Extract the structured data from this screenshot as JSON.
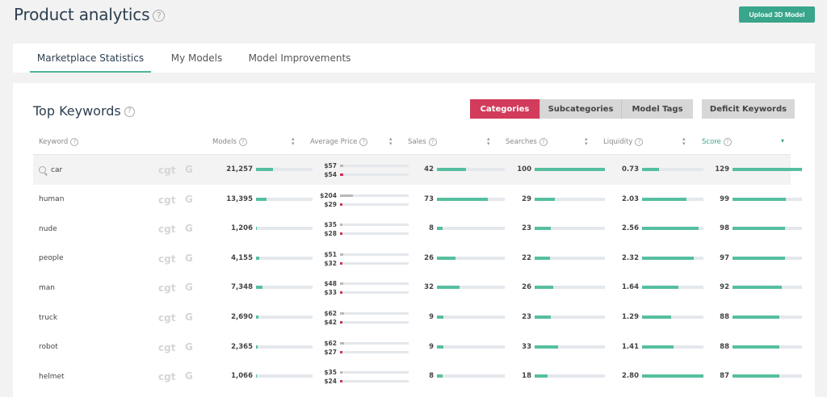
{
  "header": {
    "title": "Product analytics",
    "help_icon": "?",
    "upload_label": "Upload 3D Model"
  },
  "tabs": [
    {
      "label": "Marketplace Statistics",
      "active": true
    },
    {
      "label": "My Models",
      "active": false
    },
    {
      "label": "Model Improvements",
      "active": false
    }
  ],
  "panel": {
    "title": "Top Keywords",
    "filters": [
      {
        "label": "Categories",
        "active": true
      },
      {
        "label": "Subcategories",
        "active": false
      },
      {
        "label": "Model Tags",
        "active": false
      }
    ],
    "deficit_label": "Deficit Keywords"
  },
  "columns": {
    "keyword": "Keyword",
    "models": "Models",
    "average_price": "Average Price",
    "sales": "Sales",
    "searches": "Searches",
    "liquidity": "Liquidity",
    "score": "Score"
  },
  "brand": {
    "cgt": "cgt",
    "google": "G"
  },
  "colors": {
    "accent": "#39a58b",
    "bar": "#55bfa0",
    "active_filter": "#d23b5b",
    "price_low": "#cc3358",
    "price_high": "#b8b8b8"
  },
  "rows": [
    {
      "keyword": "car",
      "models": "21,257",
      "models_level": 0.3,
      "price_high": "$57",
      "price_high_level": 0.05,
      "price_low": "$54",
      "price_low_level": 0.05,
      "sales": "42",
      "sales_level": 0.43,
      "searches": "100",
      "searches_level": 1.0,
      "liquidity": "0.73",
      "liquidity_level": 0.27,
      "score": "129",
      "score_level": 1.0
    },
    {
      "keyword": "human",
      "models": "13,395",
      "models_level": 0.19,
      "price_high": "$204",
      "price_high_level": 0.19,
      "price_low": "$29",
      "price_low_level": 0.03,
      "sales": "73",
      "sales_level": 0.75,
      "searches": "29",
      "searches_level": 0.29,
      "liquidity": "2.03",
      "liquidity_level": 0.73,
      "score": "99",
      "score_level": 0.77
    },
    {
      "keyword": "nude",
      "models": "1,206",
      "models_level": 0.02,
      "price_high": "$35",
      "price_high_level": 0.03,
      "price_low": "$28",
      "price_low_level": 0.03,
      "sales": "8",
      "sales_level": 0.08,
      "searches": "23",
      "searches_level": 0.23,
      "liquidity": "2.56",
      "liquidity_level": 0.92,
      "score": "98",
      "score_level": 0.76
    },
    {
      "keyword": "people",
      "models": "4,155",
      "models_level": 0.06,
      "price_high": "$51",
      "price_high_level": 0.05,
      "price_low": "$32",
      "price_low_level": 0.03,
      "sales": "26",
      "sales_level": 0.27,
      "searches": "22",
      "searches_level": 0.22,
      "liquidity": "2.32",
      "liquidity_level": 0.84,
      "score": "97",
      "score_level": 0.75
    },
    {
      "keyword": "man",
      "models": "7,348",
      "models_level": 0.11,
      "price_high": "$48",
      "price_high_level": 0.05,
      "price_low": "$33",
      "price_low_level": 0.03,
      "sales": "32",
      "sales_level": 0.33,
      "searches": "26",
      "searches_level": 0.26,
      "liquidity": "1.64",
      "liquidity_level": 0.59,
      "score": "92",
      "score_level": 0.71
    },
    {
      "keyword": "truck",
      "models": "2,690",
      "models_level": 0.04,
      "price_high": "$62",
      "price_high_level": 0.06,
      "price_low": "$42",
      "price_low_level": 0.04,
      "sales": "9",
      "sales_level": 0.09,
      "searches": "23",
      "searches_level": 0.23,
      "liquidity": "1.29",
      "liquidity_level": 0.47,
      "score": "88",
      "score_level": 0.68
    },
    {
      "keyword": "robot",
      "models": "2,365",
      "models_level": 0.03,
      "price_high": "$62",
      "price_high_level": 0.06,
      "price_low": "$27",
      "price_low_level": 0.03,
      "sales": "9",
      "sales_level": 0.09,
      "searches": "33",
      "searches_level": 0.33,
      "liquidity": "1.41",
      "liquidity_level": 0.51,
      "score": "88",
      "score_level": 0.68
    },
    {
      "keyword": "helmet",
      "models": "1,066",
      "models_level": 0.02,
      "price_high": "$35",
      "price_high_level": 0.03,
      "price_low": "$24",
      "price_low_level": 0.02,
      "sales": "8",
      "sales_level": 0.08,
      "searches": "18",
      "searches_level": 0.18,
      "liquidity": "2.80",
      "liquidity_level": 1.0,
      "score": "87",
      "score_level": 0.67
    }
  ]
}
